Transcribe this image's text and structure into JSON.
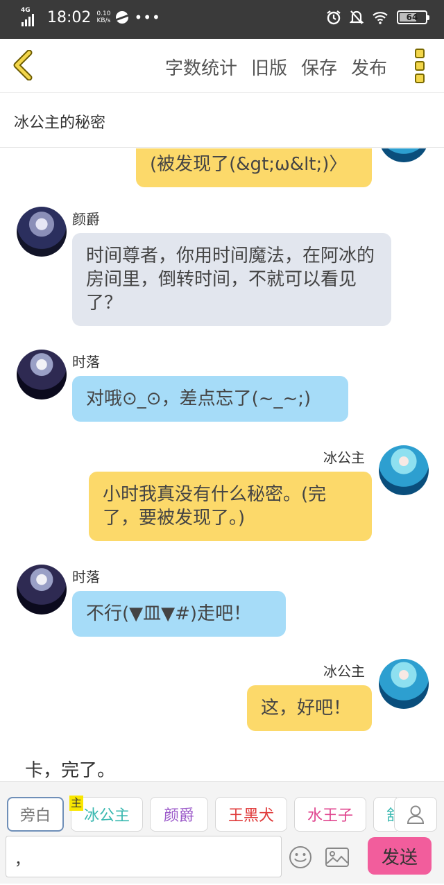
{
  "status_bar": {
    "network": "4G",
    "time": "18:02",
    "speed_value": "0.10",
    "speed_unit": "KB/s",
    "more": "•••",
    "battery": "64"
  },
  "toolbar": {
    "actions": [
      "字数统计",
      "旧版",
      "保存",
      "发布"
    ]
  },
  "story": {
    "title": "冰公主的秘密"
  },
  "messages": [
    {
      "speaker": "",
      "side": "right",
      "text": "(被发现了(&gt;ω&lt;)〉"
    },
    {
      "speaker": "颜爵",
      "side": "left",
      "text": "时间尊者，你用时间魔法，在阿冰的房间里，倒转时间，不就可以看见了？"
    },
    {
      "speaker": "时落",
      "side": "left",
      "text": "对哦⊙_⊙，差点忘了(~_~;)"
    },
    {
      "speaker": "冰公主",
      "side": "right",
      "text": "小时我真没有什么秘密。(完了，要被发现了。)"
    },
    {
      "speaker": "时落",
      "side": "left",
      "text": "不行(▼皿▼#)走吧！"
    },
    {
      "speaker": "冰公主",
      "side": "right",
      "text": "这，好吧！"
    }
  ],
  "narration": "卡，完了。",
  "roles": [
    {
      "label": "旁白",
      "color": "#777777"
    },
    {
      "label": "冰公主",
      "color": "#39b8b0"
    },
    {
      "label": "颜爵",
      "color": "#9b59c9"
    },
    {
      "label": "王黑犬",
      "color": "#e03b3b"
    },
    {
      "label": "水王子",
      "color": "#e0468f"
    },
    {
      "label": "舒",
      "color": "#39b8b0"
    }
  ],
  "main_tag": "主",
  "composer": {
    "input_value": "，",
    "send_label": "发送"
  }
}
